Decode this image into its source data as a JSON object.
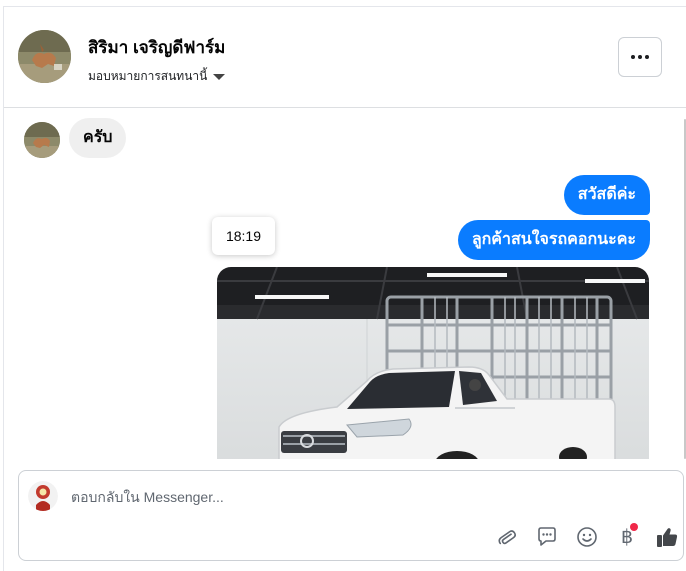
{
  "header": {
    "contact_name": "สิริมา เจริญดีฟาร์ม",
    "assign_label": "มอบหมายการสนทนานี้",
    "more_label": "ตัวเลือกเพิ่มเติม"
  },
  "messages": [
    {
      "direction": "incoming",
      "text": "ครับ"
    },
    {
      "direction": "outgoing",
      "text": "สวัสดีค่ะ"
    },
    {
      "direction": "outgoing",
      "text": "ลูกค้าสนใจรถคอกนะคะ"
    }
  ],
  "tooltip": {
    "time": "18:19"
  },
  "composer": {
    "placeholder": "ตอบกลับใน Messenger...",
    "baht_symbol": "฿"
  },
  "colors": {
    "accent": "#0a7cff",
    "incoming_bubble": "#efefef",
    "badge": "#f02849",
    "icon": "#606770"
  },
  "icons": [
    "more-options-icon",
    "caret-down-icon",
    "paperclip-icon",
    "comment-icon",
    "smiley-icon",
    "baht-icon",
    "like-icon"
  ]
}
